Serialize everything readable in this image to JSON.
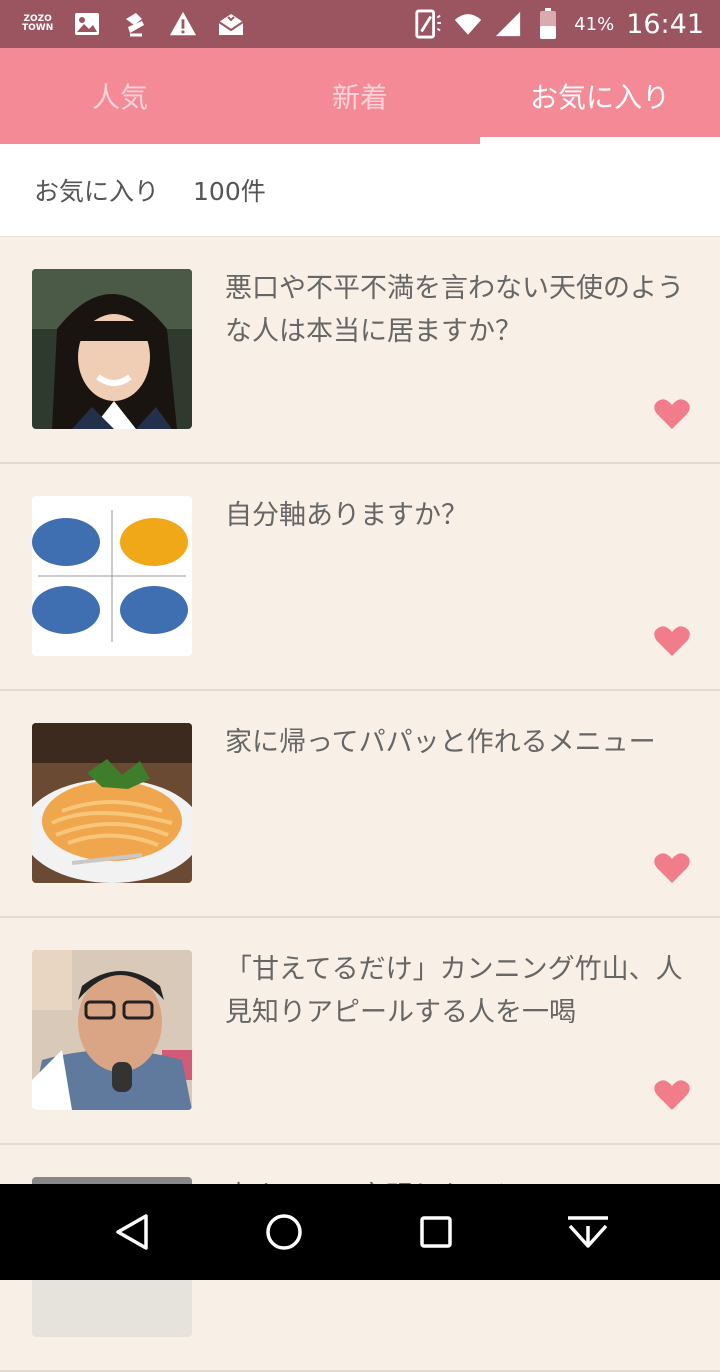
{
  "status_bar": {
    "zozo_logo": [
      "ZOZO",
      "TOWN"
    ],
    "notification_icons": [
      "image-icon",
      "download-icon",
      "warning-icon",
      "mail-icon"
    ],
    "battery_percent": "41%",
    "time": "16:41"
  },
  "tabs": [
    {
      "label": "人気",
      "active": false
    },
    {
      "label": "新着",
      "active": false
    },
    {
      "label": "お気に入り",
      "active": true
    }
  ],
  "count_bar": {
    "label": "お気に入り",
    "count": "100件"
  },
  "items": [
    {
      "title": "悪口や不平不満を言わない天使のような人は本当に居ますか？",
      "thumbnail": "portrait-girl",
      "favorited": true
    },
    {
      "title": "自分軸ありますか？",
      "thumbnail": "quadrant-diagram",
      "favorited": true
    },
    {
      "title": "家に帰ってパパッと作れるメニュー",
      "thumbnail": "pasta-dish",
      "favorited": true
    },
    {
      "title": "「甘えてるだけ」カンニング竹山、人見知りアピールする人を一喝",
      "thumbnail": "man-with-microphone",
      "favorited": true
    },
    {
      "title": "歩きいって言明したこと",
      "thumbnail": "partial",
      "favorited": true
    }
  ],
  "colors": {
    "accent": "#f48a95",
    "status_bar": "#9b5560",
    "heart": "#f27d8a",
    "list_bg": "#f8efe6"
  }
}
